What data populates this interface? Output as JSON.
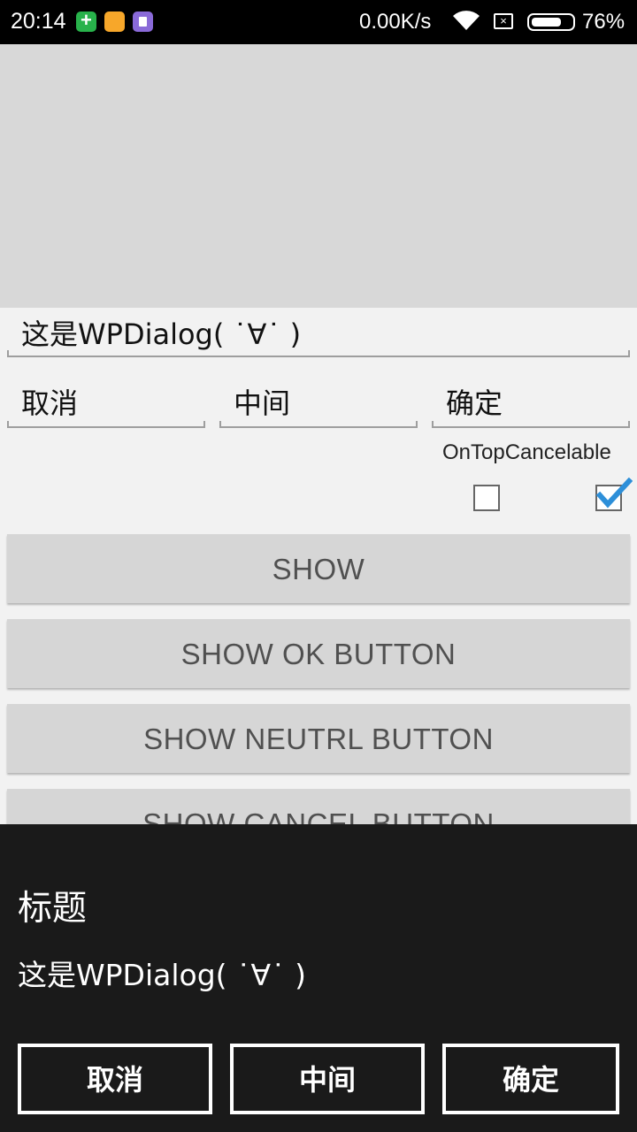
{
  "status_bar": {
    "time": "20:14",
    "net_speed": "0.00K/s",
    "sim_icon_glyph": "×",
    "battery_pct": "76%",
    "battery_level": 0.76,
    "icons": [
      "plus-app-icon",
      "folder-app-icon",
      "clone-app-icon",
      "wifi-icon",
      "no-sim-icon",
      "battery-icon"
    ]
  },
  "form": {
    "message_value": "这是WPDialog( ˙∀˙ )",
    "cancel_value": "取消",
    "neutral_value": "中间",
    "ok_value": "确定",
    "checkbox_label": "OnTopCancelable",
    "ontop_checked": false,
    "cancelable_checked": true
  },
  "buttons": {
    "show": "SHOW",
    "show_ok": "SHOW OK BUTTON",
    "show_neutral": "SHOW NEUTRL BUTTON",
    "show_cancel": "SHOW CANCEL BUTTON"
  },
  "dialog": {
    "title": "标题",
    "message": "这是WPDialog( ˙∀˙ )",
    "cancel": "取消",
    "neutral": "中间",
    "ok": "确定"
  },
  "colors": {
    "status_bar_bg": "#000000",
    "page_bg": "#f2f2f2",
    "top_panel": "#d8d8d8",
    "button_bg": "#d6d6d6",
    "dialog_bg": "#1a1a1a",
    "check_accent": "#2d8fd9"
  }
}
